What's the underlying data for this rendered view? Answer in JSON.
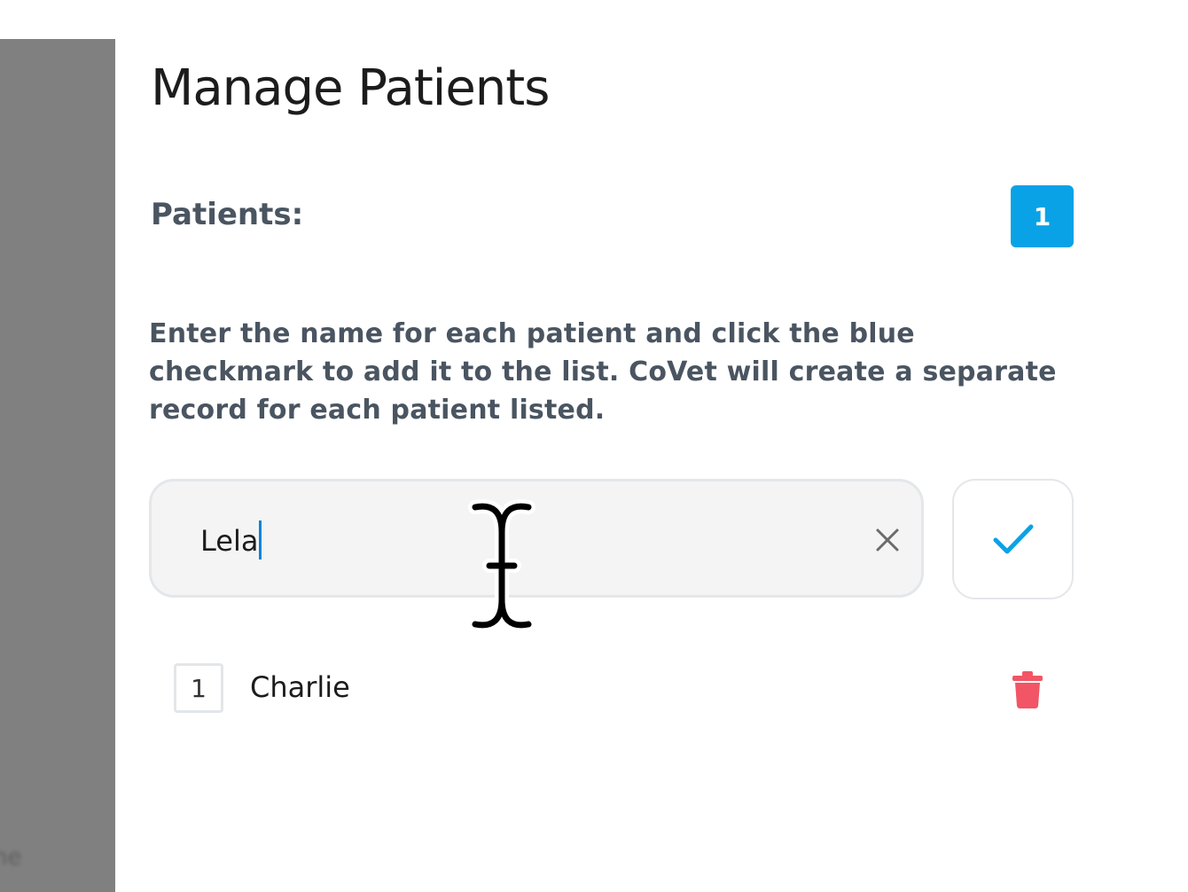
{
  "backdrop": {
    "partial_text": "ne"
  },
  "dialog": {
    "title": "Manage Patients",
    "patients_label": "Patients:",
    "patient_count": "1",
    "instructions": "Enter the name for each patient and click the blue checkmark to add it to the list. CoVet will create a separate record for each patient listed.",
    "name_input": {
      "value": "Lela",
      "clear_icon": "close-icon"
    },
    "confirm_icon": "checkmark-icon",
    "patients": [
      {
        "number": "1",
        "name": "Charlie",
        "delete_icon": "trash-icon"
      }
    ]
  },
  "colors": {
    "accent": "#0aa2e6",
    "delete": "#f25565",
    "text_secondary": "#4a5561",
    "backdrop": "#808080"
  }
}
